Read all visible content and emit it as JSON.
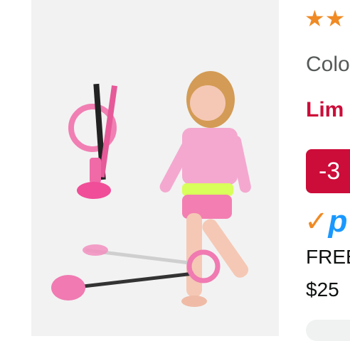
{
  "product": {
    "rating_stars": "★★",
    "colour_label": "Colo",
    "deal_label": "Lim",
    "discount_badge": "-3",
    "prime_check": "✓",
    "prime_letter": "p",
    "free_delivery": "FREE",
    "delivery_threshold": "$25"
  },
  "colors": {
    "deal_red": "#cc0c39",
    "star_orange": "#f08a24",
    "prime_blue": "#1a98ff"
  }
}
